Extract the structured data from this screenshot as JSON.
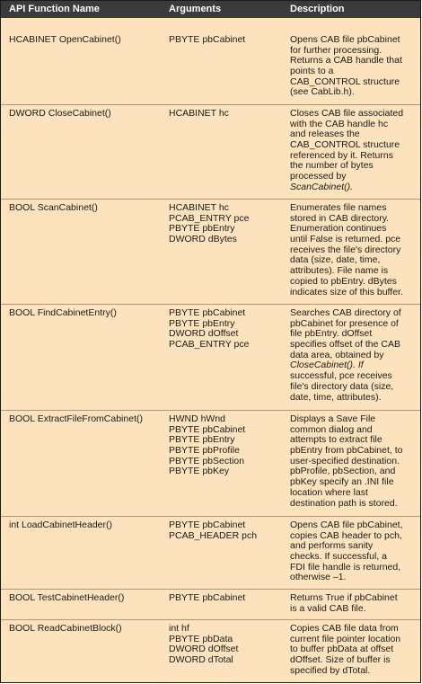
{
  "headers": {
    "function": "API Function Name",
    "arguments": "Arguments",
    "description": "Description"
  },
  "rows": [
    {
      "name": "HCABINET OpenCabinet()",
      "args": [
        "PBYTE pbCabinet"
      ],
      "desc": [
        {
          "t": "Opens CAB file pbCabinet"
        },
        {
          "t": "for further processing."
        },
        {
          "t": "Returns a CAB handle that"
        },
        {
          "t": "points to a"
        },
        {
          "t": "CAB_CONTROL structure"
        },
        {
          "t": "(see CabLib.h)."
        }
      ]
    },
    {
      "name": "DWORD CloseCabinet()",
      "args": [
        "HCABINET hc"
      ],
      "desc": [
        {
          "t": "Closes CAB file associated"
        },
        {
          "t": "with the CAB handle hc"
        },
        {
          "t": "and releases the"
        },
        {
          "t": "CAB_CONTROL structure"
        },
        {
          "t": "referenced by it. Returns"
        },
        {
          "t": "the number of bytes"
        },
        {
          "t": "processed by"
        },
        {
          "t": "ScanCabinet().",
          "em": true
        }
      ]
    },
    {
      "name": "BOOL ScanCabinet()",
      "args": [
        "HCABINET hc",
        "PCAB_ENTRY pce",
        "PBYTE pbEntry",
        "DWORD dBytes"
      ],
      "desc": [
        {
          "t": "Enumerates file names"
        },
        {
          "t": "stored in CAB directory."
        },
        {
          "t": "Enumeration continues"
        },
        {
          "t": "until False is returned. pce"
        },
        {
          "t": "receives the file's directory"
        },
        {
          "t": "data (size, date, time,"
        },
        {
          "t": "attributes). File name is"
        },
        {
          "t": "copied to pbEntry. dBytes"
        },
        {
          "t": "indicates size of this buffer."
        }
      ]
    },
    {
      "name": "BOOL FindCabinetEntry()",
      "args": [
        "PBYTE pbCabinet",
        "PBYTE pbEntry",
        "DWORD dOffset",
        "PCAB_ENTRY pce"
      ],
      "desc": [
        {
          "t": "Searches CAB directory of"
        },
        {
          "t": "pbCabinet for presence of"
        },
        {
          "t": "file pbEntry. dOffset"
        },
        {
          "t": "specifies offset of the CAB"
        },
        {
          "t": "data area, obtained by"
        },
        {
          "t": "CloseCabinet(). If",
          "em": true
        },
        {
          "t": "successful, pce receives"
        },
        {
          "t": "file's directory data (size,"
        },
        {
          "t": "date, time, attributes)."
        }
      ]
    },
    {
      "name": "BOOL ExtractFileFromCabinet()",
      "args": [
        "HWND hWnd",
        "PBYTE pbCabinet",
        "PBYTE pbEntry",
        "PBYTE pbProfile",
        "PBYTE pbSection",
        "PBYTE pbKey"
      ],
      "desc": [
        {
          "t": "Displays a Save File"
        },
        {
          "t": "common dialog and"
        },
        {
          "t": "attempts to extract file"
        },
        {
          "t": "pbEntry from pbCabinet, to"
        },
        {
          "t": "user-specified destination."
        },
        {
          "t": "pbProfile, pbSection, and"
        },
        {
          "t": "pbKey specify an .INI file"
        },
        {
          "t": "location where last"
        },
        {
          "t": "destination path is stored."
        }
      ]
    },
    {
      "name": "int LoadCabinetHeader()",
      "args": [
        "PBYTE pbCabinet",
        "PCAB_HEADER pch"
      ],
      "desc": [
        {
          "t": "Opens CAB file pbCabinet,"
        },
        {
          "t": "copies CAB header to pch,"
        },
        {
          "t": "and performs sanity"
        },
        {
          "t": "checks. If successful, a"
        },
        {
          "t": "FDI file handle is returned,"
        },
        {
          "t": "otherwise –1."
        }
      ]
    },
    {
      "name": "BOOL TestCabinetHeader()",
      "args": [
        "PBYTE pbCabinet"
      ],
      "desc": [
        {
          "t": "Returns True if pbCabinet"
        },
        {
          "t": "is a valid CAB file."
        }
      ]
    },
    {
      "name": "BOOL ReadCabinetBlock()",
      "args": [
        "int hf",
        "PBYTE pbData",
        "DWORD dOffset",
        "DWORD dTotal"
      ],
      "desc": [
        {
          "t": "Copies CAB file data from"
        },
        {
          "t": "current file pointer location"
        },
        {
          "t": "to buffer pbData at offset"
        },
        {
          "t": "dOffset. Size of buffer is"
        },
        {
          "t": "specified by dTotal."
        }
      ]
    }
  ]
}
